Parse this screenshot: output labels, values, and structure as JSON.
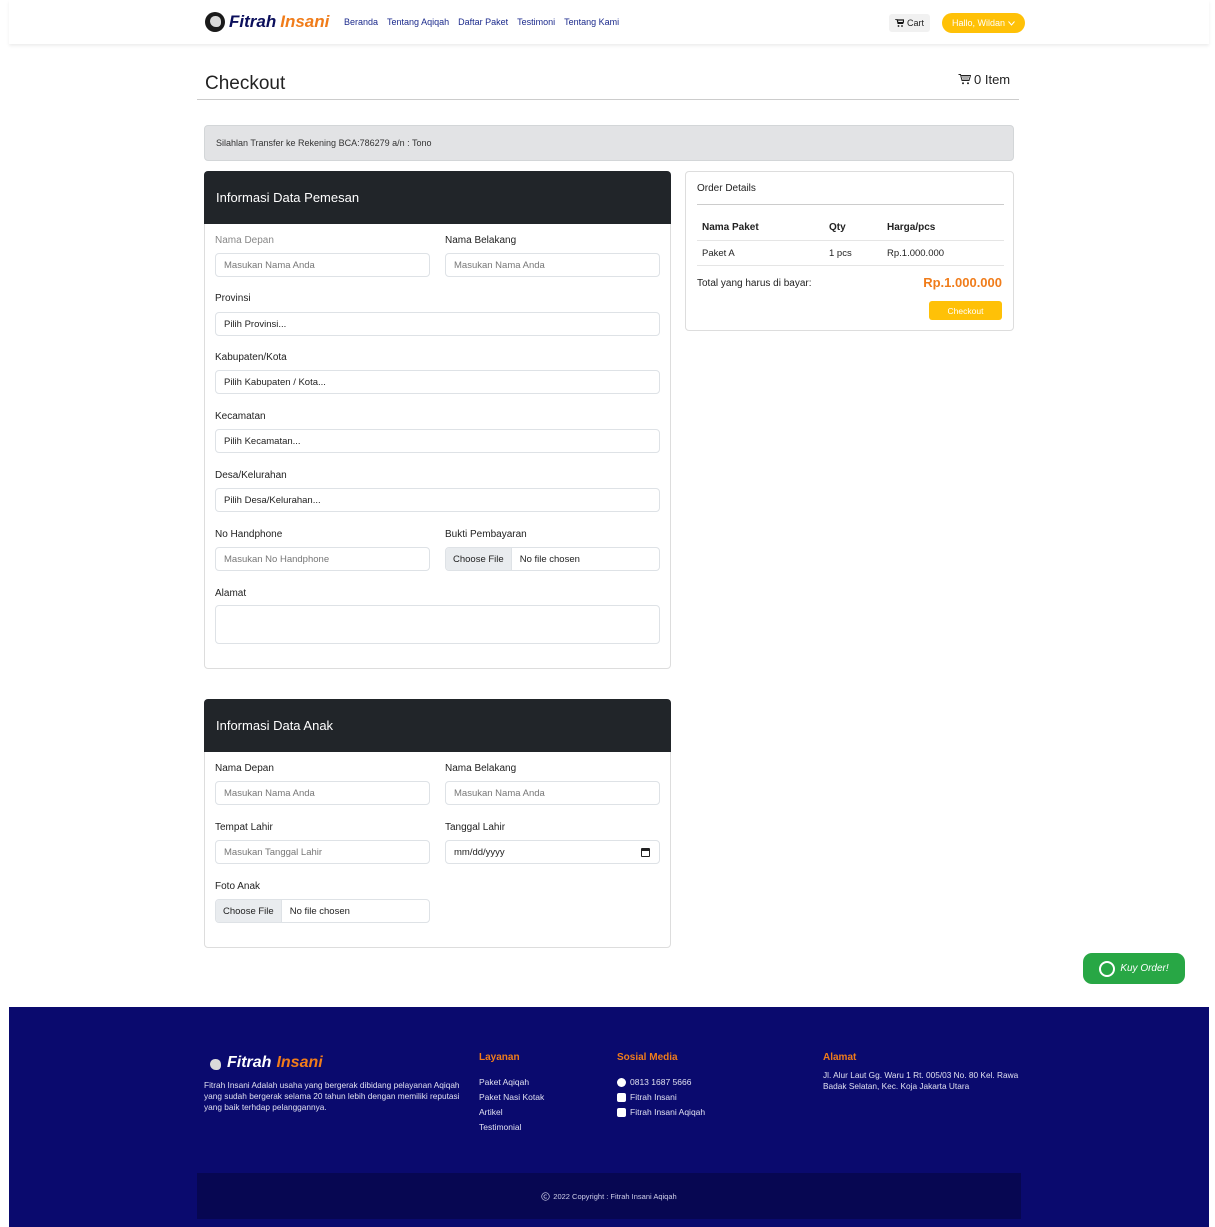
{
  "navbar": {
    "brand_part1": "Fitrah",
    "brand_part2": "Insani",
    "links": [
      "Beranda",
      "Tentang Aqiqah",
      "Daftar Paket",
      "Testimoni",
      "Tentang Kami"
    ],
    "cart_label": "Cart",
    "user_label": "Hallo, Wildan"
  },
  "header": {
    "title": "Checkout",
    "item_count": "0 Item"
  },
  "alert": "Silahlan Transfer ke Rekening BCA:786279 a/n : Tono",
  "pemesan": {
    "title": "Informasi Data Pemesan",
    "nama_depan_label": "Nama Depan",
    "nama_depan_placeholder": "Masukan Nama Anda",
    "nama_belakang_label": "Nama Belakang",
    "nama_belakang_placeholder": "Masukan Nama Anda",
    "provinsi_label": "Provinsi",
    "provinsi_value": "Pilih Provinsi...",
    "kabupaten_label": "Kabupaten/Kota",
    "kabupaten_value": "Pilih Kabupaten / Kota...",
    "kecamatan_label": "Kecamatan",
    "kecamatan_value": "Pilih Kecamatan...",
    "desa_label": "Desa/Kelurahan",
    "desa_value": "Pilih Desa/Kelurahan...",
    "hp_label": "No Handphone",
    "hp_placeholder": "Masukan No Handphone",
    "bukti_label": "Bukti Pembayaran",
    "file_button": "Choose File",
    "file_status": "No file chosen",
    "alamat_label": "Alamat",
    "alamat_value": ""
  },
  "anak": {
    "title": "Informasi Data Anak",
    "nama_depan_label": "Nama Depan",
    "nama_depan_placeholder": "Masukan Nama Anda",
    "nama_belakang_label": "Nama Belakang",
    "nama_belakang_placeholder": "Masukan Nama Anda",
    "tempat_lahir_label": "Tempat Lahir",
    "tempat_lahir_placeholder": "Masukan Tanggal Lahir",
    "tanggal_lahir_label": "Tanggal Lahir",
    "tanggal_lahir_value": "mm/dd/yyyy",
    "foto_label": "Foto Anak",
    "file_button": "Choose File",
    "file_status": "No file chosen"
  },
  "order": {
    "title": "Order Details",
    "headers": [
      "Nama Paket",
      "Qty",
      "Harga/pcs"
    ],
    "rows": [
      [
        "Paket A",
        "1 pcs",
        "Rp.1.000.000"
      ]
    ],
    "total_label": "Total yang harus di bayar:",
    "total_value": "Rp.1.000.000",
    "checkout_label": "Checkout"
  },
  "whatsapp": {
    "label": "Kuy Order!"
  },
  "footer": {
    "brand_part1": "Fitrah",
    "brand_part2": "Insani",
    "about": "Fitrah Insani Adalah usaha yang bergerak dibidang pelayanan Aqiqah yang sudah bergerak selama 20 tahun lebih dengan memiliki reputasi yang baik terhdap pelanggannya.",
    "layanan_title": "Layanan",
    "layanan": [
      "Paket Aqiqah",
      "Paket Nasi Kotak",
      "Artikel",
      "Testimonial"
    ],
    "sosmed_title": "Sosial Media",
    "sosmed": [
      "0813 1687 5666",
      "Fitrah Insani",
      "Fitrah Insani Aqiqah"
    ],
    "alamat_title": "Alamat",
    "alamat": "Jl. Alur Laut Gg. Waru 1 Rt. 005/03 No. 80 Kel. Rawa Badak Selatan, Kec. Koja Jakarta Utara",
    "copyright": "2022 Copyright : Fitrah Insani Aqiqah"
  },
  "colors": {
    "brand_navy": "#0b0f5c",
    "brand_orange": "#f07c1a",
    "accent_yellow": "#ffc107",
    "footer_bg": "#0a0a6e",
    "whatsapp_green": "#28a745"
  }
}
